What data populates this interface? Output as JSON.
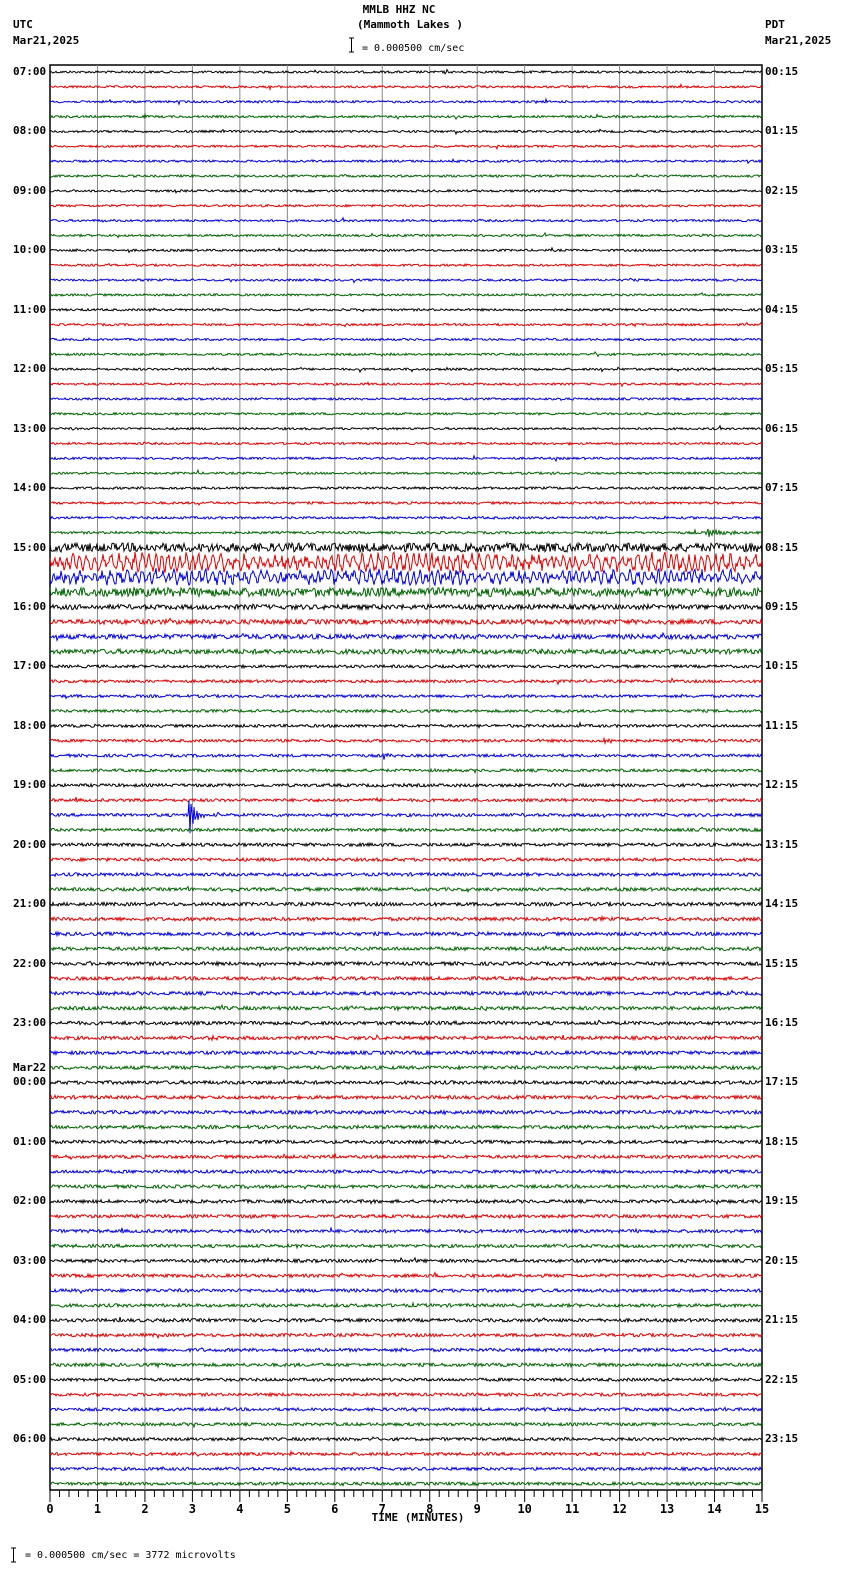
{
  "header": {
    "station": "MMLB HHZ NC",
    "location": "(Mammoth Lakes )",
    "scale": "= 0.000500 cm/sec",
    "left_tz": "UTC",
    "left_date": "Mar21,2025",
    "right_tz": "PDT",
    "right_date": "Mar21,2025"
  },
  "footer": {
    "scale_note": "= 0.000500 cm/sec =    3772 microvolts"
  },
  "chart_data": {
    "type": "line",
    "title": "MMLB HHZ NC (Mammoth Lakes )",
    "xlabel": "TIME (MINUTES)",
    "ylabel": "",
    "xlim": [
      0,
      15
    ],
    "x_ticks": [
      "0",
      "1",
      "2",
      "3",
      "4",
      "5",
      "6",
      "7",
      "8",
      "9",
      "10",
      "11",
      "12",
      "13",
      "14",
      "15"
    ],
    "traces_per_hour": 4,
    "trace_colors": [
      "#000000",
      "#e00000",
      "#0000e0",
      "#006400"
    ],
    "left_labels": [
      "07:00",
      "08:00",
      "09:00",
      "10:00",
      "11:00",
      "12:00",
      "13:00",
      "14:00",
      "15:00",
      "16:00",
      "17:00",
      "18:00",
      "19:00",
      "20:00",
      "21:00",
      "22:00",
      "23:00",
      "00:00",
      "01:00",
      "02:00",
      "03:00",
      "04:00",
      "05:00",
      "06:00"
    ],
    "date_change_label": "Mar22",
    "right_labels": [
      "00:15",
      "01:15",
      "02:15",
      "03:15",
      "04:15",
      "05:15",
      "06:15",
      "07:15",
      "08:15",
      "09:15",
      "10:15",
      "11:15",
      "12:15",
      "13:15",
      "14:15",
      "15:15",
      "16:15",
      "17:15",
      "18:15",
      "19:15",
      "20:15",
      "21:15",
      "22:15",
      "23:15"
    ],
    "hour_noise_level": [
      1,
      1,
      1,
      1,
      1,
      1,
      1,
      1.1,
      4,
      2.2,
      1.3,
      1.3,
      1.4,
      1.5,
      1.6,
      1.6,
      1.6,
      1.6,
      1.5,
      1.5,
      1.5,
      1.5,
      1.4,
      1.4
    ],
    "events": [
      {
        "trace": 31,
        "minute_start": 13.8,
        "minute_end": 15,
        "amplitude": 5
      },
      {
        "trace": 33,
        "minute_start": 0,
        "minute_end": 15,
        "amplitude": 11
      },
      {
        "trace": 34,
        "minute_start": 0,
        "minute_end": 15,
        "amplitude": 8
      },
      {
        "trace": 45,
        "minute_start": 11.6,
        "minute_end": 12.2,
        "amplitude": 5
      },
      {
        "trace": 46,
        "minute_start": 7.0,
        "minute_end": 7.3,
        "amplitude": 5
      },
      {
        "trace": 50,
        "minute_start": 2.9,
        "minute_end": 3.4,
        "amplitude": 26
      },
      {
        "trace": 65,
        "minute_start": 3.3,
        "minute_end": 3.7,
        "amplitude": 4
      }
    ]
  }
}
